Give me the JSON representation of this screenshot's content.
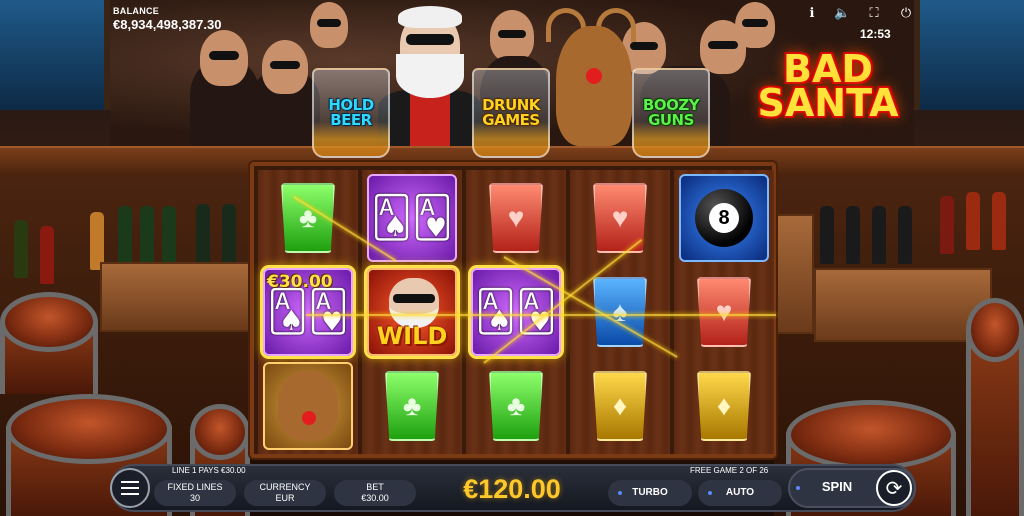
{
  "hud": {
    "balance_label": "BALANCE",
    "balance_value": "€8,934,498,387.30",
    "clock": "12:53",
    "icons": [
      "info-icon",
      "sound-icon",
      "fullscreen-icon",
      "power-icon"
    ]
  },
  "features": [
    {
      "label": "HOLD\nBEER",
      "color": "blue"
    },
    {
      "label": "DRUNK\nGAMES",
      "color": "yellow"
    },
    {
      "label": "BOOZY\nGUNS",
      "color": "green"
    }
  ],
  "logo": {
    "line1": "BAD",
    "line2": "SANTA"
  },
  "reels": {
    "columns": [
      [
        "green-club-shot",
        "purple-cards-prize",
        "reindeer"
      ],
      [
        "purple-cards",
        "santa-wild",
        "green-club-shot"
      ],
      [
        "red-heart-shot",
        "purple-cards",
        "green-club-shot"
      ],
      [
        "red-heart-shot",
        "blue-spade-shot",
        "yellow-diamond-shot"
      ],
      [
        "eight-ball",
        "red-heart-shot",
        "yellow-diamond-shot"
      ]
    ],
    "prize_value": "€30.00",
    "wild_label": "WILD",
    "eight_ball_number": "8"
  },
  "controls": {
    "line_pays": "LINE 1 PAYS €30.00",
    "free_game": "FREE GAME 2 OF 26",
    "fixed_lines_label": "FIXED LINES",
    "fixed_lines_value": "30",
    "currency_label": "CURRENCY",
    "currency_value": "EUR",
    "bet_label": "BET",
    "bet_value": "€30.00",
    "win_amount": "€120.00",
    "turbo_label": "TURBO",
    "auto_label": "AUTO",
    "spin_label": "SPIN"
  },
  "colors": {
    "accent_gold": "#ffc82a",
    "win_highlight": "#ffe24a",
    "bar_bg": "#141820"
  }
}
